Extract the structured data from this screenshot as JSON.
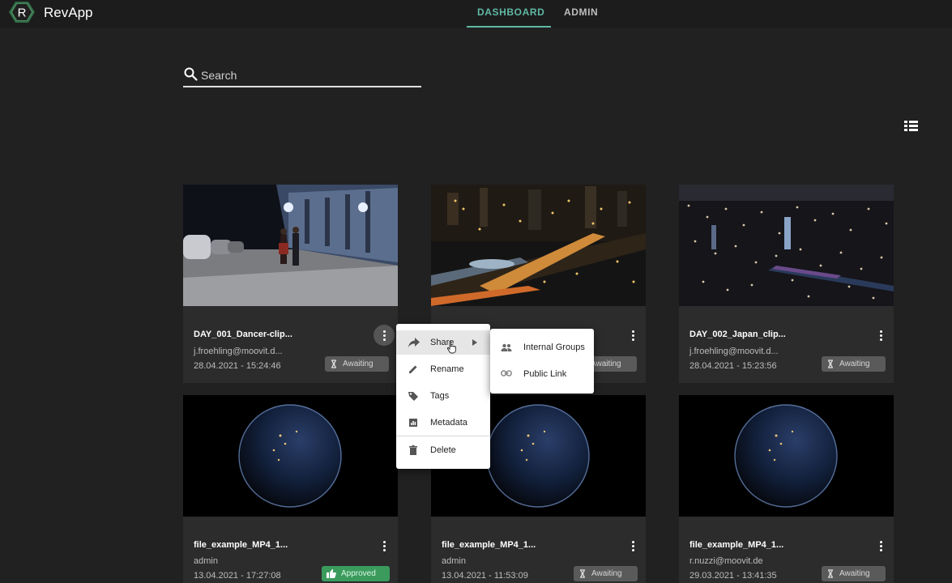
{
  "app": {
    "logo_letter": "R",
    "name": "RevApp"
  },
  "nav": {
    "tabs": [
      {
        "label": "DASHBOARD",
        "active": true
      },
      {
        "label": "ADMIN",
        "active": false
      }
    ]
  },
  "search": {
    "placeholder": "Search",
    "value": ""
  },
  "colors": {
    "accent": "#5fb9a3",
    "approved": "#3a9b5d",
    "awaiting": "#5a5a5a",
    "background": "#212121",
    "card": "#2c2c2c"
  },
  "icons": {
    "view_toggle": "list-view-icon",
    "search": "search-icon",
    "more": "more-vertical-icon",
    "awaiting": "hourglass-icon",
    "approved": "thumbs-up-icon"
  },
  "cards": [
    {
      "title": "DAY_001_Dancer-clip...",
      "owner": "j.froehling@moovit.d...",
      "date": "28.04.2021 - 15:24:46",
      "status": "Awaiting",
      "thumb": "street-night"
    },
    {
      "title": "",
      "owner": "",
      "date": "",
      "status": "Awaiting",
      "thumb": "city-river"
    },
    {
      "title": "DAY_002_Japan_clip...",
      "owner": "j.froehling@moovit.d...",
      "date": "28.04.2021 - 15:23:56",
      "status": "Awaiting",
      "thumb": "city-aerial"
    },
    {
      "title": "file_example_MP4_1...",
      "owner": "admin",
      "date": "13.04.2021 - 17:27:08",
      "status": "Approved",
      "thumb": "earth"
    },
    {
      "title": "file_example_MP4_1...",
      "owner": "admin",
      "date": "13.04.2021 - 11:53:09",
      "status": "Awaiting",
      "thumb": "earth"
    },
    {
      "title": "file_example_MP4_1...",
      "owner": "r.nuzzi@moovit.de",
      "date": "29.03.2021 - 13:41:35",
      "status": "Awaiting",
      "thumb": "earth"
    }
  ],
  "context_menu": {
    "items": [
      {
        "label": "Share",
        "icon": "share-icon",
        "has_submenu": true
      },
      {
        "label": "Rename",
        "icon": "pencil-icon"
      },
      {
        "label": "Tags",
        "icon": "tag-icon"
      },
      {
        "label": "Metadata",
        "icon": "metadata-icon"
      },
      {
        "label": "Delete",
        "icon": "trash-icon"
      }
    ],
    "submenu": [
      {
        "label": "Internal Groups",
        "icon": "group-icon"
      },
      {
        "label": "Public Link",
        "icon": "link-icon"
      }
    ]
  }
}
